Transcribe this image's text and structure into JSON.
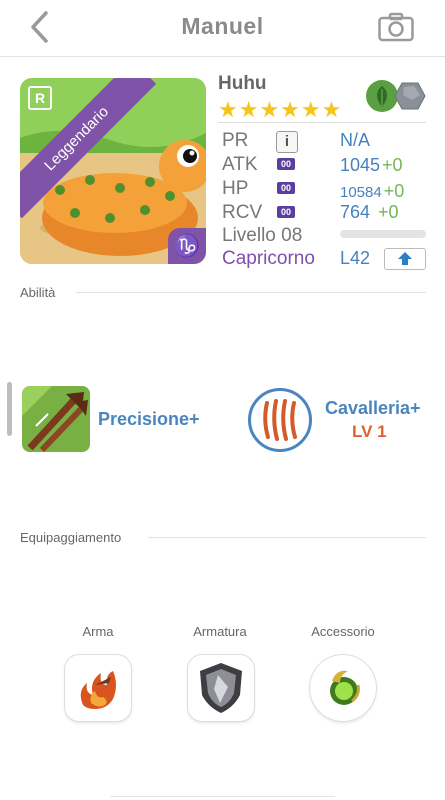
{
  "header": {
    "title": "Manuel",
    "back_icon": "chevron-left-icon",
    "camera_icon": "camera-icon"
  },
  "card": {
    "rarity_ribbon": "Leggendario",
    "rarity_badge": "R",
    "zodiac_symbol": "♑",
    "name": "Huhu",
    "stars": "★★★★★★",
    "star_count": 6,
    "elements": [
      "leaf-element-icon",
      "rock-element-icon"
    ]
  },
  "stats": {
    "pr": {
      "label": "PR",
      "info": "i",
      "value": "N/A"
    },
    "atk": {
      "label": "ATK",
      "badge": "00",
      "value": "1045",
      "bonus": "+0"
    },
    "hp": {
      "label": "HP",
      "badge": "00",
      "value": "10584",
      "bonus": "+0"
    },
    "rcv": {
      "label": "RCV",
      "badge": "00",
      "value": "764",
      "bonus": "+0"
    },
    "level": {
      "label": "Livello 08",
      "progress": 0
    },
    "zodiac": "Capricorno",
    "level_cap": "L42"
  },
  "abilities": {
    "section_label": "Abilità",
    "skill": {
      "name": "Precisione+",
      "icon": "arrows-skill-icon"
    },
    "leader": {
      "name": "Cavalleria+",
      "level": "LV 1",
      "icon": "claw-marks-icon"
    }
  },
  "equipment": {
    "section_label": "Equipaggiamento",
    "slots": [
      {
        "label": "Arma",
        "icon": "fire-weapon-icon"
      },
      {
        "label": "Armatura",
        "icon": "armor-shield-icon"
      },
      {
        "label": "Accessorio",
        "icon": "green-orb-accessory-icon"
      }
    ]
  },
  "colors": {
    "accent_blue": "#4682c0",
    "purple": "#7f54a8",
    "green_bonus": "#77b655",
    "orange_level": "#e0612a",
    "star": "#f5c518"
  }
}
